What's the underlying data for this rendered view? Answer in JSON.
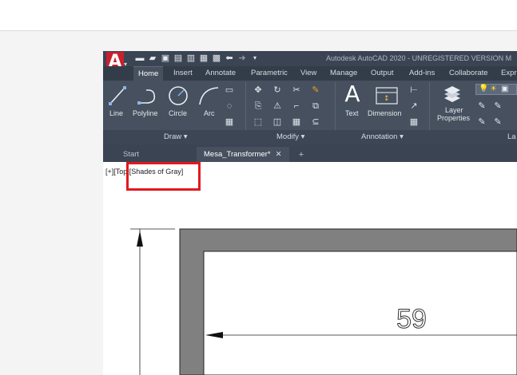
{
  "window": {
    "title": "Autodesk AutoCAD 2020 - UNREGISTERED VERSION   M",
    "logo_letter": "A",
    "quick_access": [
      "new-icon",
      "open-icon",
      "save-icon",
      "save-as-icon",
      "plot-icon",
      "publish-icon",
      "print-icon",
      "undo-icon",
      "redo-icon",
      "workspace-menu-icon"
    ]
  },
  "ribbon_tabs": [
    {
      "label": "Home",
      "active": true
    },
    {
      "label": "Insert"
    },
    {
      "label": "Annotate"
    },
    {
      "label": "Parametric"
    },
    {
      "label": "View"
    },
    {
      "label": "Manage"
    },
    {
      "label": "Output"
    },
    {
      "label": "Add-ins"
    },
    {
      "label": "Collaborate"
    },
    {
      "label": "Expr"
    }
  ],
  "ribbon": {
    "draw": {
      "title": "Draw ▾",
      "tools": {
        "line": "Line",
        "polyline": "Polyline",
        "circle": "Circle",
        "arc": "Arc"
      }
    },
    "modify": {
      "title": "Modify ▾"
    },
    "annotation": {
      "title": "Annotation ▾",
      "tools": {
        "text": "Text",
        "dimension": "Dimension"
      }
    },
    "layers": {
      "title": "La",
      "tools": {
        "layer_properties_line1": "Layer",
        "layer_properties_line2": "Properties"
      }
    }
  },
  "file_tabs": {
    "start": "Start",
    "current": "Mesa_Transformer*",
    "close_glyph": "✕",
    "new_tab_glyph": "+"
  },
  "viewport": {
    "label": "[+][Top][Shades of Gray]",
    "dimension_value": "59"
  },
  "colors": {
    "title_bar": "#3b4453",
    "ribbon": "#46505f",
    "logo_red": "#c8202e",
    "highlight_red": "#e1191e",
    "part_gray": "#808080"
  }
}
